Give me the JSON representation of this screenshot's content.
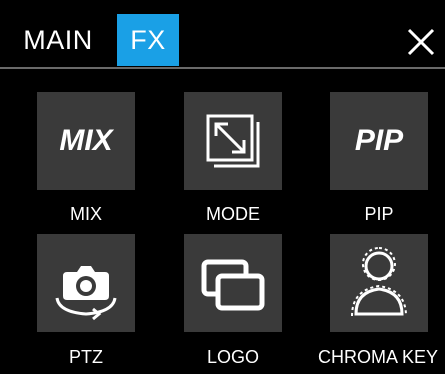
{
  "tabs": [
    {
      "label": "MAIN",
      "active": false
    },
    {
      "label": "FX",
      "active": true
    }
  ],
  "accent_color": "#1aa0e6",
  "close_icon": "close-icon",
  "tiles": [
    {
      "icon_text": "MIX",
      "icon": "mix-text-icon",
      "label": "MIX"
    },
    {
      "icon": "resize-expand-icon",
      "label": "MODE"
    },
    {
      "icon_text": "PIP",
      "icon": "pip-text-icon",
      "label": "PIP"
    },
    {
      "icon": "camera-rotate-icon",
      "label": "PTZ"
    },
    {
      "icon": "overlapping-windows-icon",
      "label": "LOGO"
    },
    {
      "icon": "person-silhouette-icon",
      "label": "CHROMA KEY"
    }
  ]
}
